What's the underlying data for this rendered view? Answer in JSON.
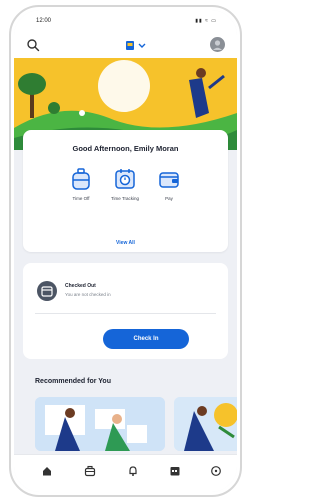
{
  "status_bar": {
    "time": "12:00",
    "signal_icon": "signal-icon",
    "wifi_icon": "wifi-icon",
    "battery_icon": "battery-icon",
    "icons_text": "▮▮ ≈ ▭"
  },
  "app_bar": {
    "search_icon": "search-icon",
    "logo_icon": "company-logo-icon",
    "avatar_icon": "avatar-icon"
  },
  "greeting": {
    "text": "Good Afternoon, Emily Moran"
  },
  "quick_actions": [
    {
      "label": "Time Off",
      "icon": "luggage-icon"
    },
    {
      "label": "Time Tracking",
      "icon": "time-tracking-icon"
    },
    {
      "label": "Pay",
      "icon": "wallet-icon"
    }
  ],
  "view_all": "View All",
  "check_status": {
    "title": "Checked Out",
    "subtitle": "You are not checked in",
    "button": "Check In"
  },
  "recommended": {
    "title": "Recommended for You"
  },
  "bottom_nav": [
    {
      "icon": "home-icon"
    },
    {
      "icon": "briefcase-icon"
    },
    {
      "icon": "bell-icon"
    },
    {
      "icon": "calendar-icon"
    },
    {
      "icon": "chat-icon"
    }
  ],
  "colors": {
    "accent": "#1565d8",
    "hero_yellow": "#f6c22b",
    "background": "#eef0f5"
  }
}
